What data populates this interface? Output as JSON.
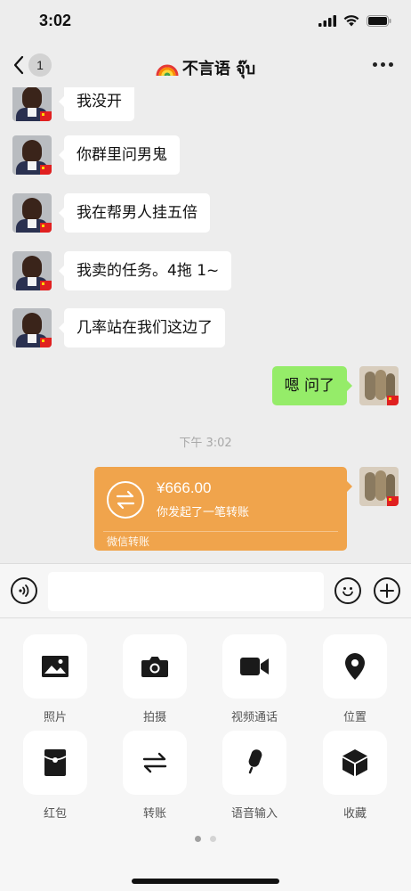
{
  "status_bar": {
    "time": "3:02"
  },
  "nav": {
    "unread_count": "1",
    "title": "不言语 จุ๊บ",
    "title_icon": "rainbow-icon"
  },
  "messages": [
    {
      "side": "left",
      "text": "我没开"
    },
    {
      "side": "left",
      "text": "你群里问男鬼"
    },
    {
      "side": "left",
      "text": "我在帮男人挂五倍"
    },
    {
      "side": "left",
      "text": "我卖的任务。4拖 1~"
    },
    {
      "side": "left",
      "text": "几率站在我们这边了"
    },
    {
      "side": "right",
      "text": "嗯 问了"
    }
  ],
  "timestamp": "下午 3:02",
  "transfer": {
    "amount": "¥666.00",
    "description": "你发起了一笔转账",
    "footer": "微信转账",
    "color": "#f0a44c"
  },
  "input": {
    "value": "",
    "placeholder": ""
  },
  "panel": {
    "tiles": [
      {
        "label": "照片",
        "icon": "image-icon"
      },
      {
        "label": "拍摄",
        "icon": "camera-icon"
      },
      {
        "label": "视频通话",
        "icon": "video-call-icon"
      },
      {
        "label": "位置",
        "icon": "location-icon"
      },
      {
        "label": "红包",
        "icon": "red-packet-icon"
      },
      {
        "label": "转账",
        "icon": "transfer-icon"
      },
      {
        "label": "语音输入",
        "icon": "microphone-icon"
      },
      {
        "label": "收藏",
        "icon": "favorites-icon"
      }
    ],
    "page_count": 2,
    "current_page": 1
  },
  "colors": {
    "bubble_self": "#95ec69",
    "bubble_other": "#ffffff",
    "background": "#ededed"
  }
}
